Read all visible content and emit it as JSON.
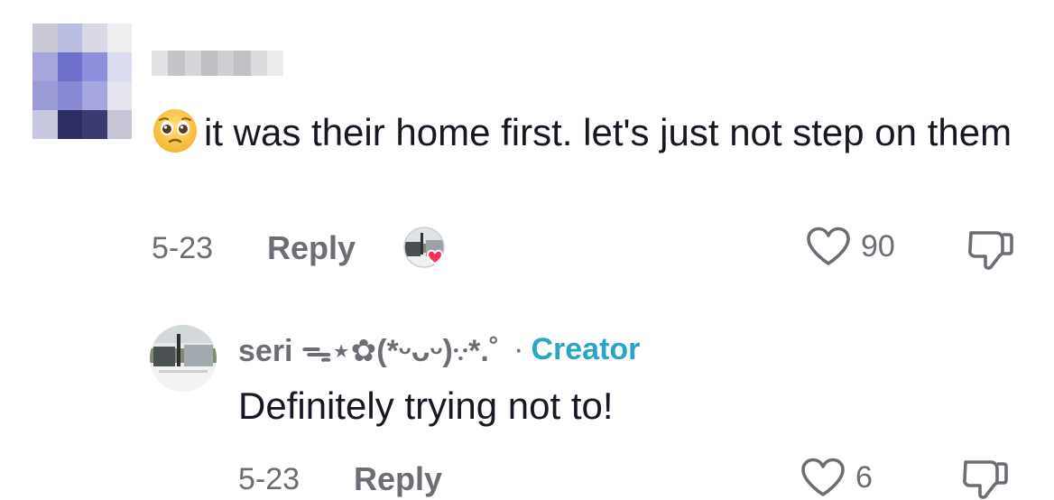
{
  "comment": {
    "text": "it was their home first. let's just not step on them",
    "date": "5-23",
    "reply_label": "Reply",
    "likes": "90",
    "emoji": "pleading-face",
    "liked_by_creator": true
  },
  "reply": {
    "author": "seri ᯓ⋆✿(*ᵕᴗᵕ)𐬺*.˚",
    "separator": "·",
    "badge": "Creator",
    "text": "Definitely trying not to!",
    "date": "5-23",
    "reply_label": "Reply",
    "likes": "6"
  },
  "colors": {
    "meta_gray": "#6b6e75",
    "creator_accent": "#2aa5c3",
    "heart_red": "#fe2c55"
  },
  "icons": {
    "like": "heart-outline-icon",
    "dislike": "thumb-down-outline-icon"
  }
}
